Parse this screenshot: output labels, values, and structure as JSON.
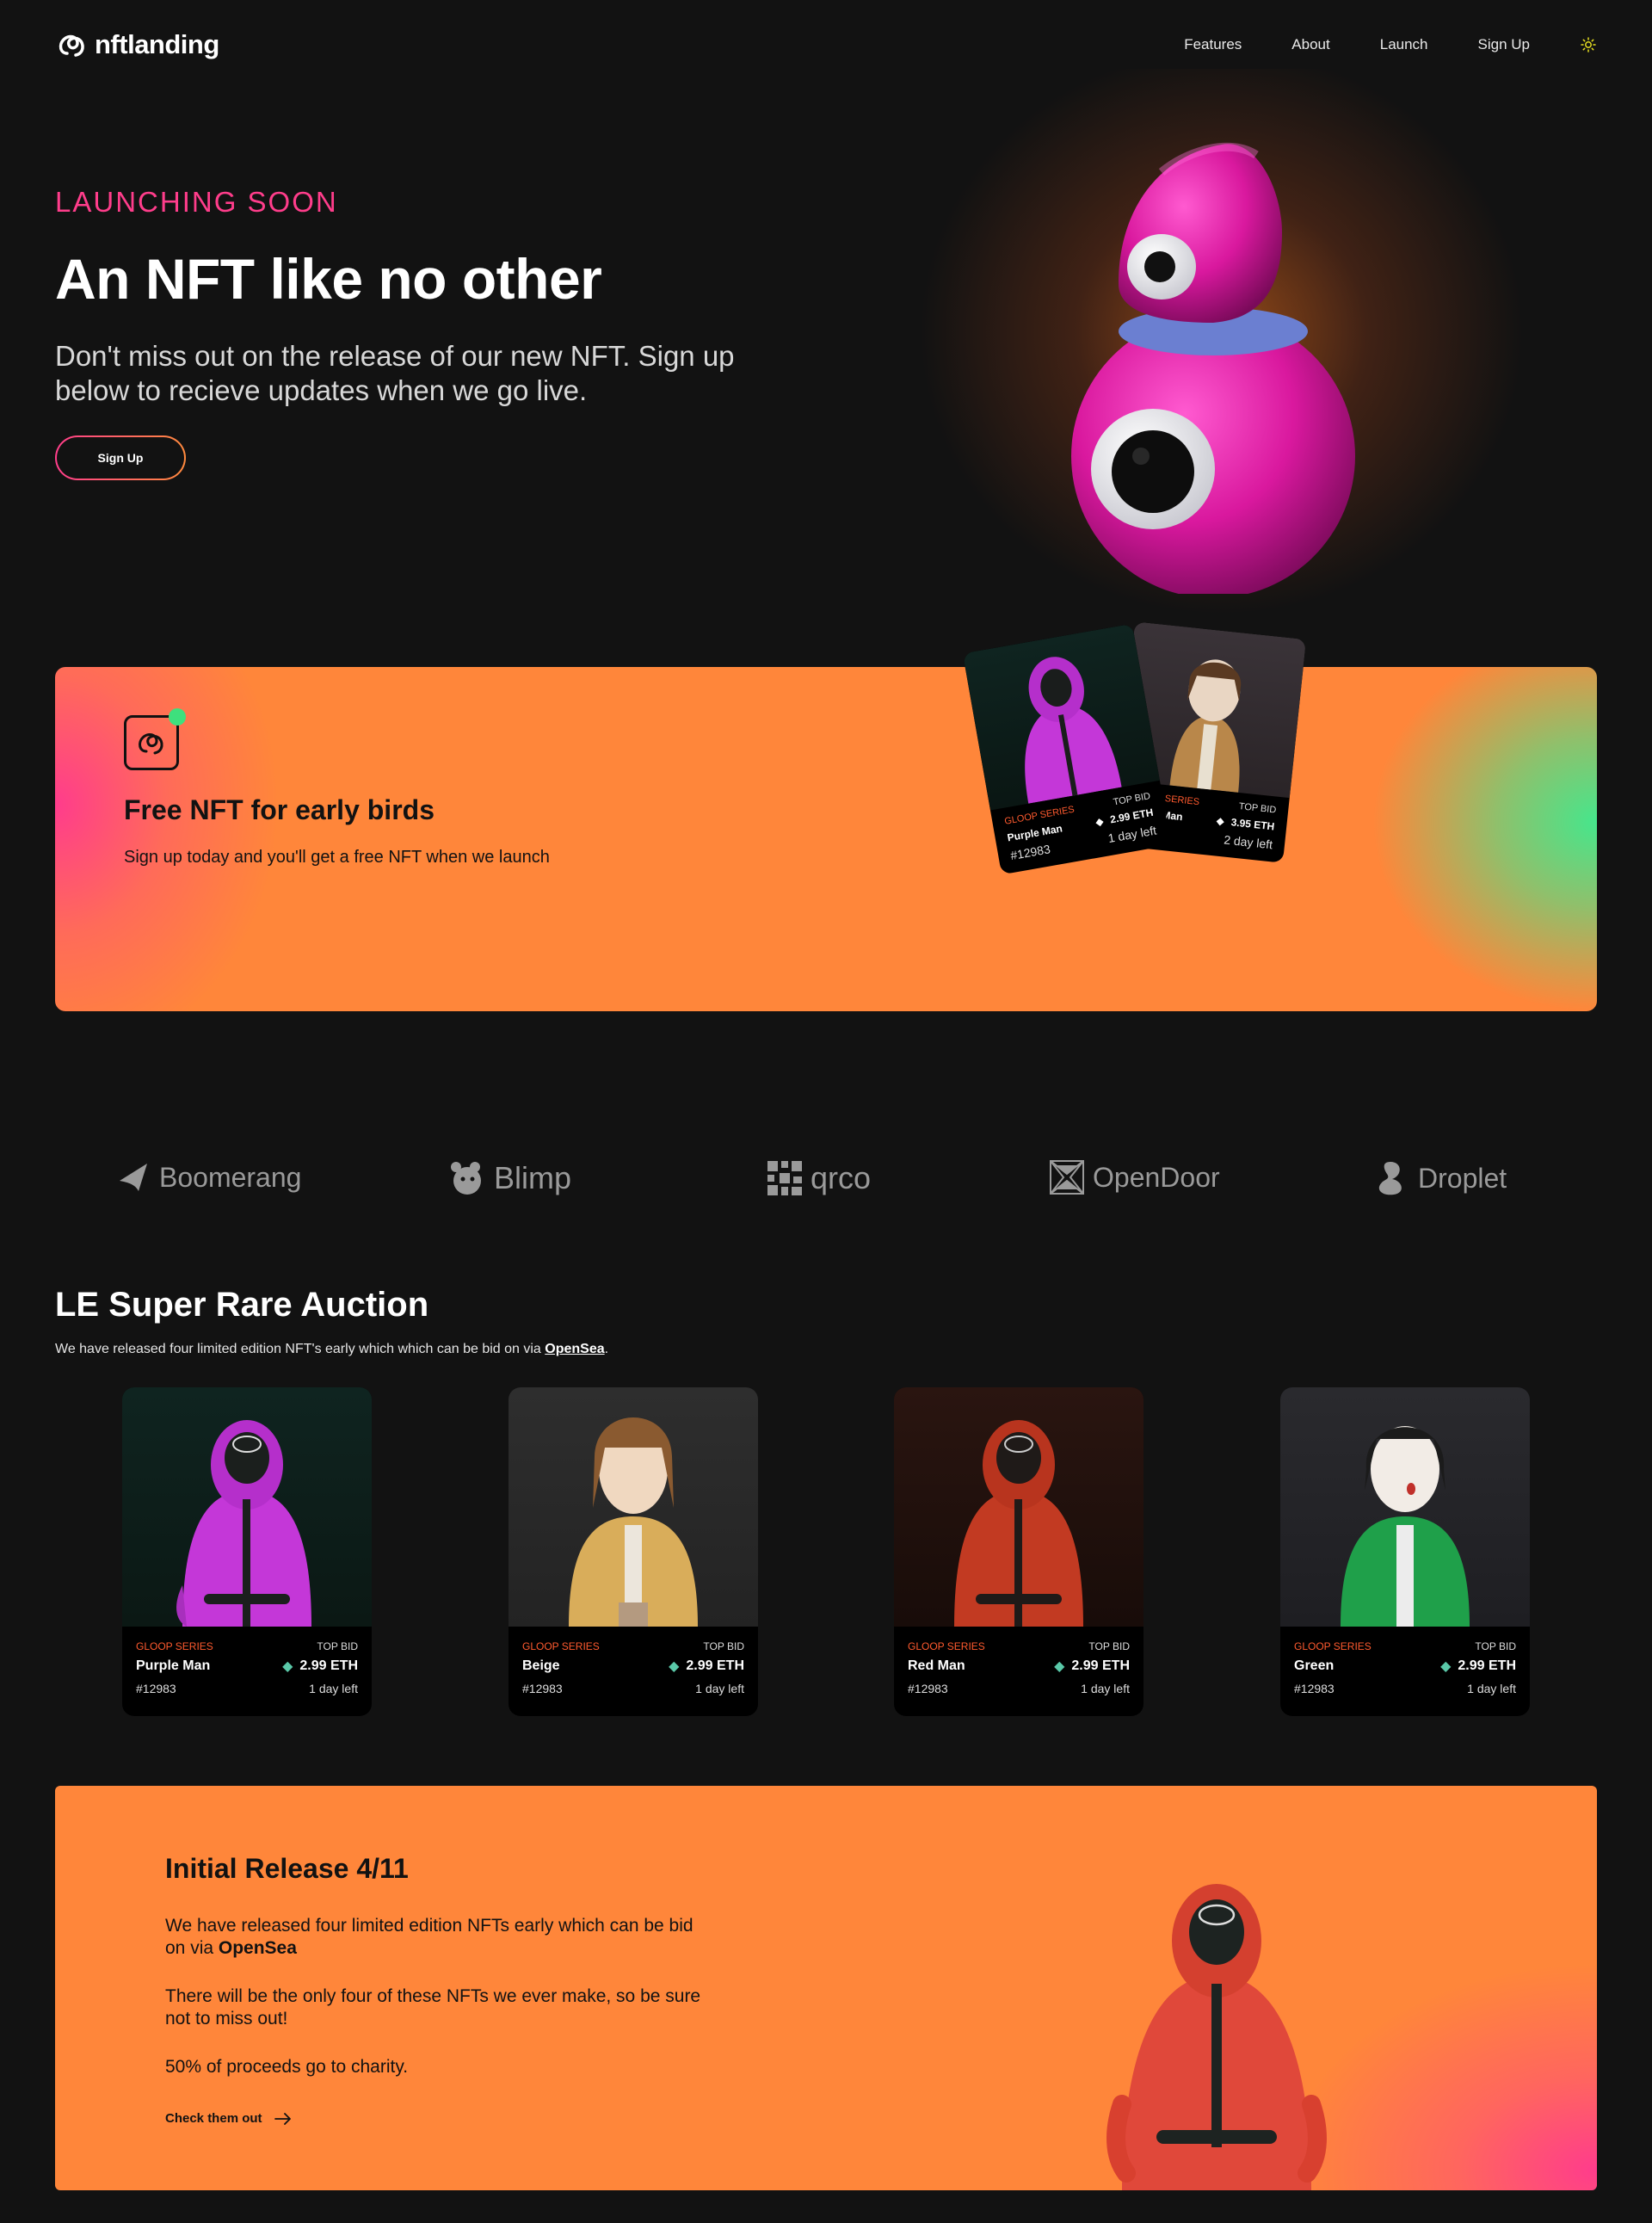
{
  "nav": {
    "logo_text": "nftlanding",
    "links": [
      "Features",
      "About",
      "Launch",
      "Sign Up"
    ],
    "theme_icon": "sun-icon"
  },
  "hero": {
    "eyebrow": "LAUNCHING SOON",
    "title": "An NFT like no other",
    "subtitle": "Don't miss out on the release of our new NFT. Sign up below to recieve updates when we go live.",
    "button": "Sign Up"
  },
  "early": {
    "icon": "logo-icon",
    "title": "Free NFT for early birds",
    "text": "Sign up today and you'll get a free NFT when we launch",
    "cards": [
      {
        "series": "GLOOP SERIES",
        "top_bid": "TOP BID",
        "name": "Purple Man",
        "price": "2.99 ETH",
        "id": "#12983",
        "time": "1 day left"
      },
      {
        "series": "GLOOP SERIES",
        "top_bid": "TOP BID",
        "name": "Purple Man",
        "price": "3.95 ETH",
        "id": "",
        "time": "2 day left"
      }
    ]
  },
  "partners": [
    "Boomerang",
    "Blimp",
    "qrco",
    "OpenDoor",
    "Droplet"
  ],
  "auction": {
    "title": "LE Super Rare Auction",
    "subtitle_pre": "We have released four limited edition NFT's early which which can be bid on via ",
    "subtitle_link": "OpenSea",
    "subtitle_post": ".",
    "cards": [
      {
        "series": "GLOOP SERIES",
        "top_bid": "TOP BID",
        "name": "Purple Man",
        "price": "2.99 ETH",
        "id": "#12983",
        "time": "1 day left"
      },
      {
        "series": "GLOOP SERIES",
        "top_bid": "TOP BID",
        "name": "Beige",
        "price": "2.99 ETH",
        "id": "#12983",
        "time": "1 day left"
      },
      {
        "series": "GLOOP SERIES",
        "top_bid": "TOP BID",
        "name": "Red Man",
        "price": "2.99 ETH",
        "id": "#12983",
        "time": "1 day left"
      },
      {
        "series": "GLOOP SERIES",
        "top_bid": "TOP BID",
        "name": "Green",
        "price": "2.99 ETH",
        "id": "#12983",
        "time": "1 day left"
      }
    ]
  },
  "release": {
    "title": "Initial Release 4/11",
    "p1_pre": "We have released four limited edition NFTs early which can be bid on via ",
    "p1_link": "OpenSea",
    "p2": "There will be the only four of these NFTs we ever make, so be sure not to miss out!",
    "p3": "50% of proceeds go to charity.",
    "link": "Check them out"
  },
  "colors": {
    "accent_pink": "#ff3d8b",
    "accent_orange": "#ff863a",
    "accent_green": "#3ee07d",
    "background": "#121212"
  }
}
